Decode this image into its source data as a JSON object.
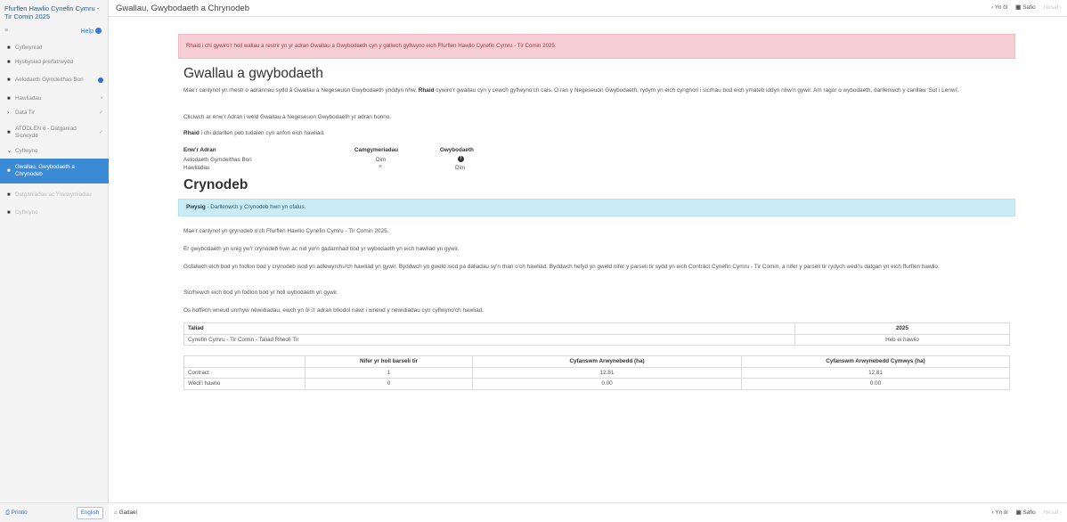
{
  "sidebar": {
    "title": "Ffurflen Hawlio Cynefin Cymru - Tir Comin 2025",
    "help_label": "Help",
    "items": [
      {
        "label": "Cyflwyniad",
        "icon": "square-icon",
        "state": "normal"
      },
      {
        "label": "Hysbysiad preifatrwydd",
        "icon": "square-icon",
        "state": "normal"
      },
      {
        "label": "Aelodaeth Gymdeithas Bori",
        "icon": "square-icon",
        "state": "normal",
        "badge": "info-dot"
      },
      {
        "label": "Hawliadau",
        "icon": "square-icon",
        "state": "normal",
        "indicator": "x"
      },
      {
        "label": "Data Tir",
        "icon": "chevron-right-icon",
        "state": "normal",
        "indicator": "check"
      },
      {
        "label": "ATODLEN 6 - Datganiad Sicrwydd",
        "icon": "square-icon",
        "state": "normal",
        "indicator": "check"
      },
      {
        "label": "Cyflwyno",
        "icon": "chevron-down-icon",
        "state": "normal"
      },
      {
        "label": "Gwallau, Gwybodaeth a Chrynodeb",
        "icon": "square-icon",
        "state": "active"
      },
      {
        "label": "Datganiadau ac Ymrwymiadau",
        "icon": "square-icon",
        "state": "disabled"
      },
      {
        "label": "Cyflwyno",
        "icon": "square-icon",
        "state": "disabled"
      }
    ],
    "print_label": "Printio",
    "lang_label": "English"
  },
  "header": {
    "title": "Gwallau, Gwybodaeth a Chrynodeb",
    "prev_label": "Yn ôl",
    "save_label": "Safio",
    "next_label": "Nesaf"
  },
  "footer": {
    "exit_label": "Gadael",
    "prev_label": "Yn ôl",
    "save_label": "Safio",
    "next_label": "Nesaf"
  },
  "main": {
    "alert_danger": "Rhaid i chi gywiro'r holl wallau a restrir yn yr adran Gwallau a Gwybodaeth cyn y gallwch gyflwyno eich Ffurflen Hawlio Cynefin Cymru - Tir Comin 2025.",
    "errors_heading": "Gwallau a gwybodaeth",
    "errors_p1_pre": "Mae'r canlynol yn rhestr o adrannau sydd â Gwallau a Negeseuon Gwybodaeth ynddyn nhw. ",
    "errors_p1_bold": "Rhaid",
    "errors_p1_post": " cywiro'r gwallau cyn y cewch gyflwyno'ch cais. O ran y Negeseuon Gwybodaeth, rydym yn eich cynghori i sicrhau bod eich ymateb iddyn nhw'n gywir. Am ragor o wybodaeth, darllenwch y canllaw 'Sut i Lenwi'.",
    "errors_p2": "Cliciwch ar enw'r Adran i weld Gwallau a Negeseuon Gwybodaeth yr adran honno.",
    "errors_p3_bold": "Rhaid",
    "errors_p3_post": " i chi ddarllen pob tudalen cyn anfon eich hawliad.",
    "error_table": {
      "headers": [
        "Enw'r Adran",
        "Camgymeriadau",
        "Gwybodaeth"
      ],
      "rows": [
        {
          "section": "Aelodaeth Gymdeithas Bori",
          "errors": "Dim",
          "info": "!"
        },
        {
          "section": "Hawliadau",
          "errors": "×",
          "info": "Dim"
        }
      ]
    },
    "summary_heading": "Crynodeb",
    "alert_info_bold": "Pwysig",
    "alert_info_text": " - Darllenwch y Crynodeb hwn yn ofalus.",
    "summary_p1": "Mae'r canlynol yn grynodeb o'ch Ffurflen Hawlio Cynefin Cymru - Tir Comin 2025.",
    "summary_p2": "Er gwybodaeth yn unig yw'r crynodeb hwn ac nid yw'n gadarnhad bod yr wybodaeth yn eich hawliad yn gywir.",
    "summary_p3": "Gofalwch eich bod yn fodlon bod y crynodeb isod yn adlewyrchu'ch hawliad yn gywir. Byddwch yn gweld isod pa daliadau sy'n rhan o'ch hawliad. Byddwch hefyd yn gweld nifer y parseli tir sydd yn eich Contract Cynefin Cymru - Tir Comin, a nifer y parseli tir rydych wedi'u datgan yn eich ffurflen hawlio.",
    "summary_p4": "Sicrhewch eich bod yn fodlon bod yr holl wybodaeth yn gywir.",
    "summary_p5": "Os hoffech wneud unrhyw newidiadau, ewch yn ôl i'r adran briodol nawr i wneud y newidiadau cyn cyflwyno'ch hawliad.",
    "payment_table": {
      "headers": [
        "Taliad",
        "2025"
      ],
      "rows": [
        [
          "Cynefin Cymru - Tir Comin - Taliad Rheoli Tir",
          "Heb ei hawlio"
        ]
      ]
    },
    "parcel_table": {
      "headers": [
        "",
        "Nifer yr holl barseli tir",
        "Cyfanswm Arwynebedd (ha)",
        "Cyfanswm Arwynebedd Cymwys (ha)"
      ],
      "rows": [
        [
          "Contract",
          "1",
          "12.81",
          "12.81"
        ],
        [
          "Wedi'i hawlio",
          "0",
          "0.00",
          "0.00"
        ]
      ]
    }
  }
}
